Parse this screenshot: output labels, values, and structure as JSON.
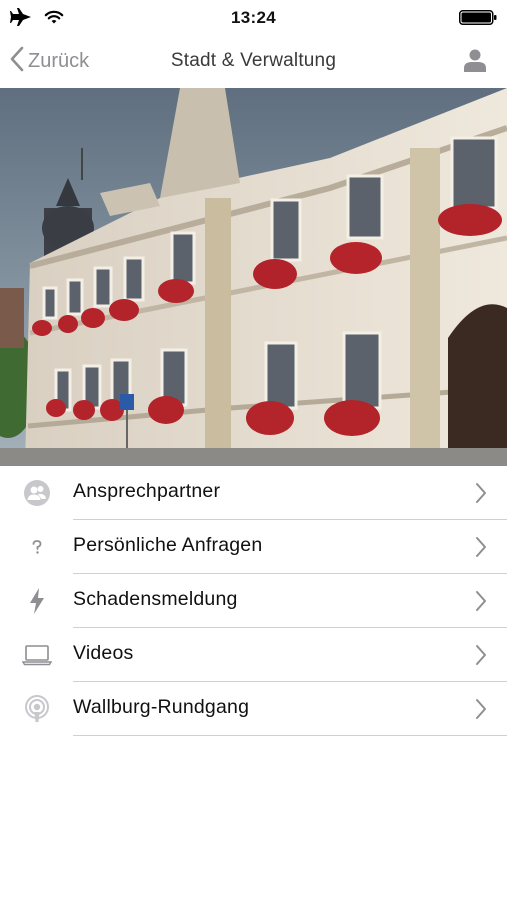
{
  "status_bar": {
    "time": "13:24",
    "icons": [
      "airplane-icon",
      "wifi-icon",
      "battery-icon"
    ]
  },
  "nav": {
    "back_label": "Zurück",
    "title": "Stadt & Verwaltung",
    "right_icon": "user-icon"
  },
  "hero": {
    "subject": "town-hall-building-photo"
  },
  "menu": {
    "items": [
      {
        "label": "Ansprechpartner",
        "icon": "contacts-icon"
      },
      {
        "label": "Persönliche Anfragen",
        "icon": "question-icon"
      },
      {
        "label": "Schadensmeldung",
        "icon": "lightning-icon"
      },
      {
        "label": "Videos",
        "icon": "laptop-icon"
      },
      {
        "label": "Wallburg-Rundgang",
        "icon": "podcast-icon"
      }
    ]
  },
  "colors": {
    "accent_gray": "#8e8e93",
    "divider": "#cfcfd4",
    "text": "#111111"
  }
}
